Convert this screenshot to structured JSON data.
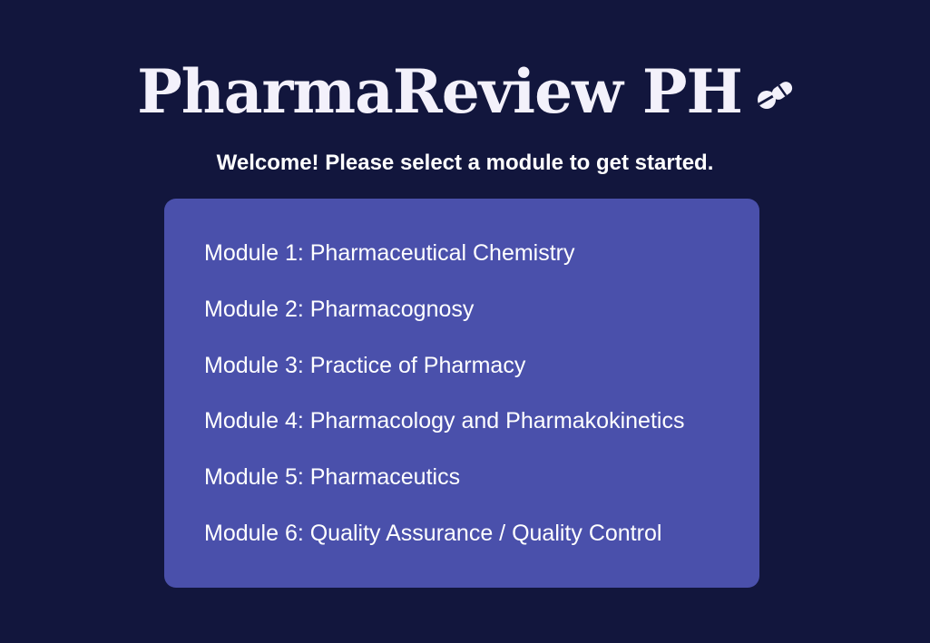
{
  "header": {
    "title": "PharmaReview PH",
    "icon": "pill-icon"
  },
  "welcome_text": "Welcome! Please select a module to get started.",
  "colors": {
    "background": "#12163d",
    "panel": "#4a50ab",
    "text": "#ffffff"
  },
  "modules": [
    {
      "label": "Module 1: Pharmaceutical Chemistry"
    },
    {
      "label": "Module 2: Pharmacognosy"
    },
    {
      "label": "Module 3: Practice of Pharmacy"
    },
    {
      "label": "Module 4: Pharmacology and Pharmakokinetics"
    },
    {
      "label": "Module 5: Pharmaceutics"
    },
    {
      "label": "Module 6: Quality Assurance / Quality Control"
    }
  ]
}
